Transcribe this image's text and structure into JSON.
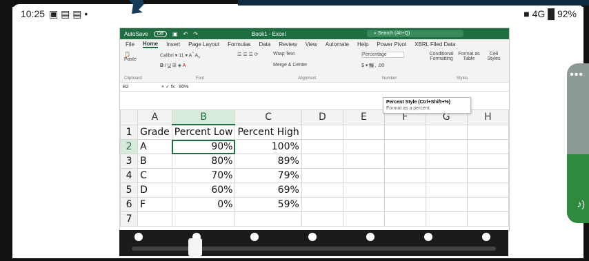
{
  "status": {
    "time": "10:25",
    "right": "■ 4G █ 92%"
  },
  "excel": {
    "autosave": "AutoSave",
    "autosave_state": "Off",
    "title": "Book1 - Excel",
    "search": "Search (Alt+Q)",
    "menu": [
      "File",
      "Home",
      "Insert",
      "Page Layout",
      "Formulas",
      "Data",
      "Review",
      "View",
      "Automate",
      "Help",
      "Power Pivot",
      "XBRL Filed Data"
    ],
    "ribbon": {
      "font": "Calibri",
      "size": "11",
      "wrap": "Wrap Text",
      "merge": "Merge & Center",
      "numfmt": "Percentage",
      "condfmt": "Conditional Formatting",
      "fmt_table": "Format as Table",
      "cell_styles": "Cell Styles",
      "groups": [
        "Clipboard",
        "Font",
        "Alignment",
        "Number",
        "Styles"
      ],
      "paste": "Paste"
    },
    "namebox": "B2",
    "formula": "90%",
    "tooltip": {
      "title": "Percent Style (Ctrl+Shift+%)",
      "desc": "Format as a percent."
    },
    "columns": [
      "A",
      "B",
      "C",
      "D",
      "E",
      "F",
      "G",
      "H"
    ],
    "rows": [
      [
        "Grade",
        "Percent Low",
        "Percent High"
      ],
      [
        "A",
        "90%",
        "100%"
      ],
      [
        "B",
        "80%",
        "89%"
      ],
      [
        "C",
        "70%",
        "79%"
      ],
      [
        "D",
        "60%",
        "69%"
      ],
      [
        "F",
        "0%",
        "59%"
      ],
      [
        "",
        "",
        ""
      ]
    ]
  }
}
